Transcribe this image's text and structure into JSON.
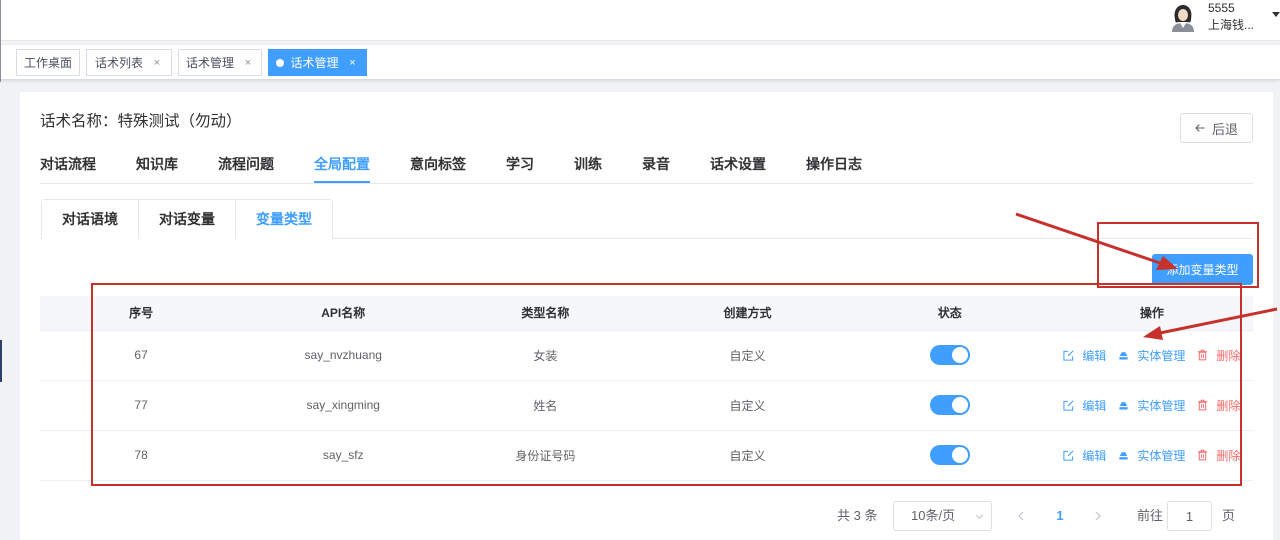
{
  "colors": {
    "primary": "#409eff",
    "danger": "#f56c6c",
    "annotation": "#c7312b"
  },
  "icons": {
    "avatar": "user-avatar-icon",
    "caret": "caret-down-icon",
    "back": "arrow-left-icon",
    "edit": "edit-icon",
    "entity": "entity-manage-icon",
    "delete": "trash-icon",
    "select": "chevron-down-icon",
    "prev": "chevron-left-icon",
    "next": "chevron-right-icon"
  },
  "header": {
    "user_name": "5555",
    "user_org": "上海钱..."
  },
  "tags_view": [
    {
      "label": "工作桌面",
      "active": false
    },
    {
      "label": "话术列表",
      "close": "×",
      "active": false
    },
    {
      "label": "话术管理",
      "close": "×",
      "active": false
    },
    {
      "label": "话术管理",
      "close": "×",
      "active": true
    }
  ],
  "page": {
    "title": "话术名称：特殊测试（勿动）",
    "back_label": "后退",
    "tabs": [
      {
        "label": "对话流程",
        "active": false
      },
      {
        "label": "知识库",
        "active": false
      },
      {
        "label": "流程问题",
        "active": false
      },
      {
        "label": "全局配置",
        "active": true
      },
      {
        "label": "意向标签",
        "active": false
      },
      {
        "label": "学习",
        "active": false
      },
      {
        "label": "训练",
        "active": false
      },
      {
        "label": "录音",
        "active": false
      },
      {
        "label": "话术设置",
        "active": false
      },
      {
        "label": "操作日志",
        "active": false
      }
    ],
    "sub_tabs": [
      {
        "label": "对话语境",
        "active": false
      },
      {
        "label": "对话变量",
        "active": false
      },
      {
        "label": "变量类型",
        "active": true
      }
    ],
    "add_button_label": "添加变量类型"
  },
  "table": {
    "columns": [
      "序号",
      "API名称",
      "类型名称",
      "创建方式",
      "状态",
      "操作"
    ],
    "rows": [
      {
        "id": "67",
        "api_name": "say_nvzhuang",
        "type_name": "女装",
        "create_method": "自定义",
        "status": true
      },
      {
        "id": "77",
        "api_name": "say_xingming",
        "type_name": "姓名",
        "create_method": "自定义",
        "status": true
      },
      {
        "id": "78",
        "api_name": "say_sfz",
        "type_name": "身份证号码",
        "create_method": "自定义",
        "status": true
      }
    ],
    "actions": {
      "edit": "编辑",
      "entity": "实体管理",
      "delete": "删除"
    }
  },
  "pagination": {
    "total_text": "共 3 条",
    "page_size": "10条/页",
    "current_page": "1",
    "goto_label": "前往",
    "goto_value": "1",
    "page_suffix": "页"
  }
}
